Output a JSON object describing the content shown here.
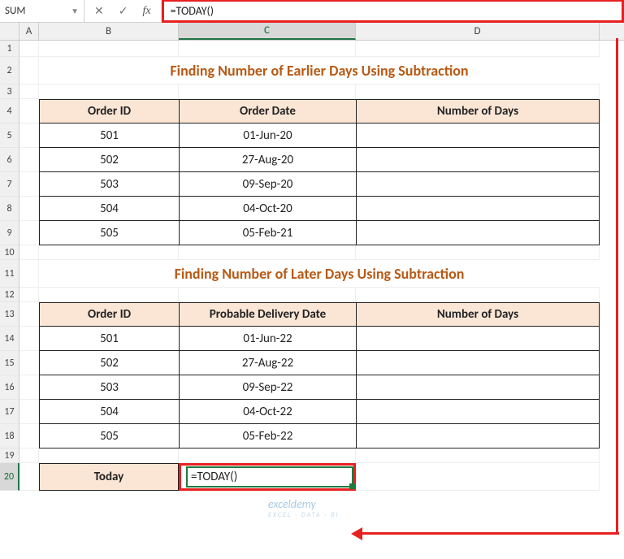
{
  "nameBox": "SUM",
  "formulaBar": "=TODAY()",
  "columns": {
    "A": "A",
    "B": "B",
    "C": "C",
    "D": "D"
  },
  "rowNums": [
    "1",
    "2",
    "3",
    "4",
    "5",
    "6",
    "7",
    "8",
    "9",
    "10",
    "11",
    "12",
    "13",
    "14",
    "15",
    "16",
    "17",
    "18",
    "19",
    "20"
  ],
  "title1": "Finding Number of Earlier Days Using Subtraction",
  "title2": "Finding Number of Later Days Using Subtraction",
  "headers1": {
    "b": "Order ID",
    "c": "Order Date",
    "d": "Number of Days"
  },
  "headers2": {
    "b": "Order ID",
    "c": "Probable Delivery Date",
    "d": "Number of Days"
  },
  "table1": [
    {
      "id": "501",
      "date": "01-Jun-20",
      "days": ""
    },
    {
      "id": "502",
      "date": "27-Aug-20",
      "days": ""
    },
    {
      "id": "503",
      "date": "09-Sep-20",
      "days": ""
    },
    {
      "id": "504",
      "date": "04-Oct-20",
      "days": ""
    },
    {
      "id": "505",
      "date": "05-Feb-21",
      "days": ""
    }
  ],
  "table2": [
    {
      "id": "501",
      "date": "01-Jun-22",
      "days": ""
    },
    {
      "id": "502",
      "date": "27-Aug-22",
      "days": ""
    },
    {
      "id": "503",
      "date": "09-Sep-22",
      "days": ""
    },
    {
      "id": "504",
      "date": "04-Oct-22",
      "days": ""
    },
    {
      "id": "505",
      "date": "05-Feb-22",
      "days": ""
    }
  ],
  "todayLabel": "Today",
  "todayValue": "=TODAY()",
  "watermark": {
    "main": "exceldemy",
    "sub": "EXCEL · DATA · BI"
  }
}
